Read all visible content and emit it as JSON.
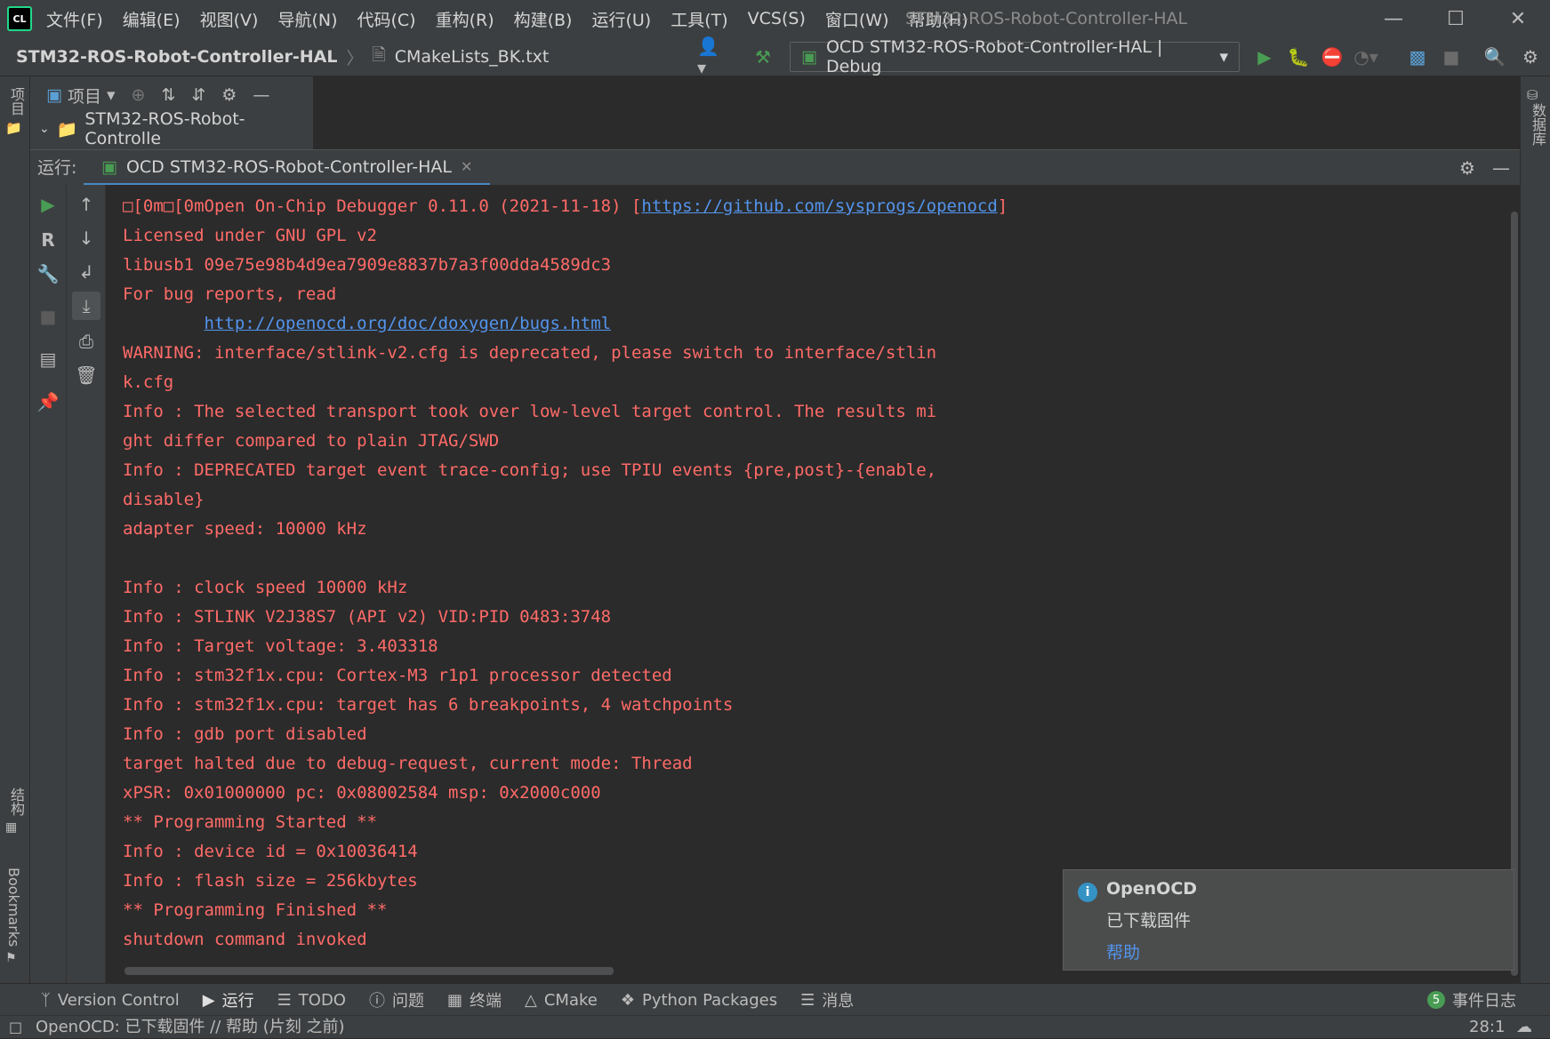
{
  "app": {
    "logo_text": "CL",
    "window_title": "STM32-ROS-Robot-Controller-HAL"
  },
  "menu": [
    "文件(F)",
    "编辑(E)",
    "视图(V)",
    "导航(N)",
    "代码(C)",
    "重构(R)",
    "构建(B)",
    "运行(U)",
    "工具(T)",
    "VCS(S)",
    "窗口(W)",
    "帮助(H)"
  ],
  "breadcrumb": {
    "project": "STM32-ROS-Robot-Controller-HAL",
    "file": "CMakeLists_BK.txt"
  },
  "run_config": {
    "label": "OCD STM32-ROS-Robot-Controller-HAL | Debug"
  },
  "left_stripe": {
    "project": "项目",
    "structure": "结构",
    "bookmarks": "Bookmarks"
  },
  "right_stripe": {
    "database": "数据库"
  },
  "project_pane": {
    "view_label": "项目",
    "root_node": "STM32-ROS-Robot-Controlle"
  },
  "run_window": {
    "label": "运行:",
    "tab": "OCD STM32-ROS-Robot-Controller-HAL"
  },
  "console": {
    "line0_prefix": "□[0m□[0mOpen On-Chip Debugger 0.11.0 (2021-11-18) [",
    "line0_link": "https://github.com/sysprogs/openocd",
    "line0_suffix": "]",
    "line1": "Licensed under GNU GPL v2",
    "line2": "libusb1 09e75e98b4d9ea7909e8837b7a3f00dda4589dc3",
    "line3": "For bug reports, read",
    "line4_indent": "        ",
    "line4_link": "http://openocd.org/doc/doxygen/bugs.html",
    "lines_rest": [
      "WARNING: interface/stlink-v2.cfg is deprecated, please switch to interface/stlin",
      "k.cfg",
      "Info : The selected transport took over low-level target control. The results mi",
      "ght differ compared to plain JTAG/SWD",
      "Info : DEPRECATED target event trace-config; use TPIU events {pre,post}-{enable,",
      "disable}",
      "adapter speed: 10000 kHz",
      "",
      "Info : clock speed 10000 kHz",
      "Info : STLINK V2J38S7 (API v2) VID:PID 0483:3748",
      "Info : Target voltage: 3.403318",
      "Info : stm32f1x.cpu: Cortex-M3 r1p1 processor detected",
      "Info : stm32f1x.cpu: target has 6 breakpoints, 4 watchpoints",
      "Info : gdb port disabled",
      "target halted due to debug-request, current mode: Thread",
      "xPSR: 0x01000000 pc: 0x08002584 msp: 0x2000c000",
      "** Programming Started **",
      "Info : device id = 0x10036414",
      "Info : flash size = 256kbytes",
      "** Programming Finished **",
      "shutdown command invoked"
    ]
  },
  "notification": {
    "icon": "i",
    "title": "OpenOCD",
    "body": "已下载固件",
    "link": "帮助"
  },
  "bottom_tabs": {
    "version_control": "Version Control",
    "run": "运行",
    "todo": "TODO",
    "problems": "问题",
    "terminal": "终端",
    "cmake": "CMake",
    "python_packages": "Python Packages",
    "messages": "消息",
    "event_log": "事件日志",
    "event_count": "5"
  },
  "status": {
    "text": "OpenOCD: 已下载固件 // 帮助 (片刻 之前)",
    "position": "28:1"
  },
  "colors": {
    "console_text": "#ff6b68",
    "link": "#5394ec",
    "accent": "#4a88c7",
    "run_green": "#499c54"
  }
}
